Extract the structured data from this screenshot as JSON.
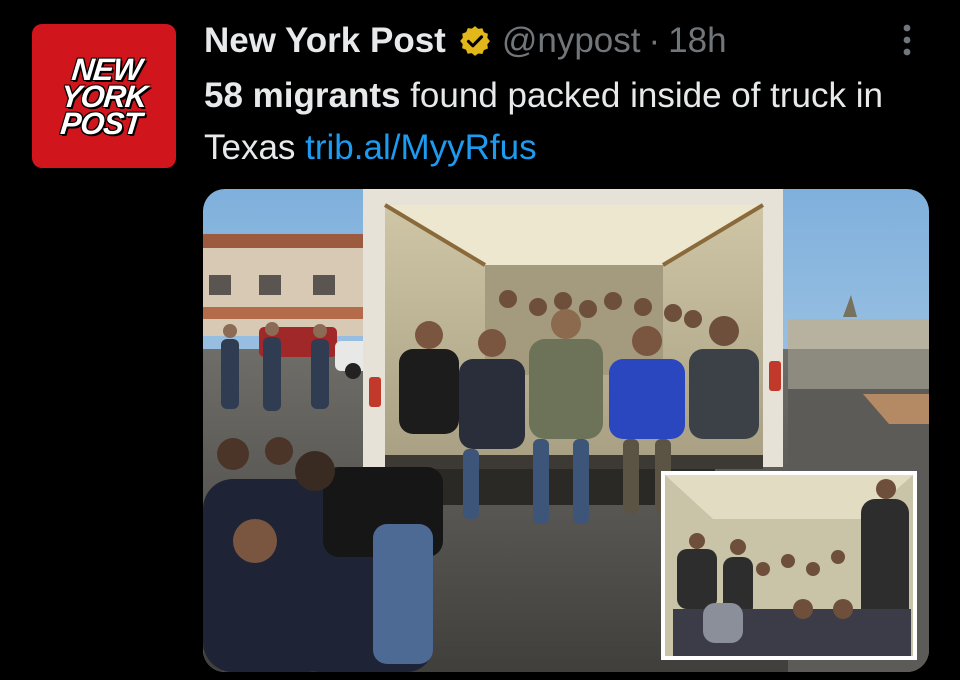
{
  "account": {
    "display_name": "New York Post",
    "handle": "@nypost",
    "separator": "·",
    "time": "18h",
    "avatar_lines": [
      "NEW",
      "YORK",
      "POST"
    ],
    "verified_icon": "verified-gold-badge-icon",
    "more_icon": "more-vertical-icon"
  },
  "tweet": {
    "text_bold": "58 migrants",
    "text_rest": " found packed inside of truck in Texas ",
    "link": "trib.al/MyyRfus"
  },
  "colors": {
    "background": "#000000",
    "text": "#e7e9ea",
    "muted": "#71767b",
    "link": "#1d9bf0",
    "brand_red": "#d0151c",
    "verified_gold": "#e2b719"
  }
}
